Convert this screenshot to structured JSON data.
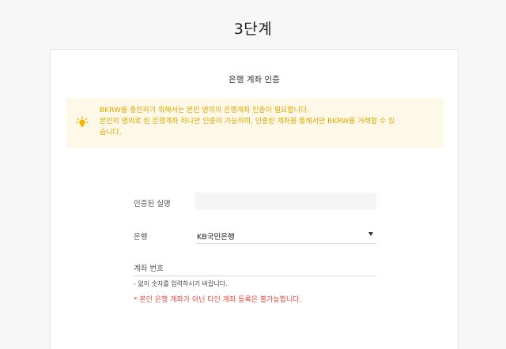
{
  "step_title": "3단계",
  "card": {
    "title": "은행 계좌 인증",
    "notice": {
      "icon": "lightbulb-icon",
      "color": "#e0a800",
      "line1": "BKRW를 충전하기 위해서는 본인 명의의 은행계좌 인증이 필요합니다.",
      "line2": "본인의 명의로 된 은행계좌 하나만 인증이 가능하며, 인증된 계좌를 통해서만 BKRW를 거래할 수 있",
      "line3": "습니다."
    },
    "form": {
      "name_label": "인증된 실명",
      "name_value": "",
      "bank_label": "은행",
      "bank_selected": "KB국민은행",
      "account_placeholder": "계좌 번호",
      "hint": "- 없이 숫자를 입력하시기 바랍니다.",
      "warning": "* 본인 은행 계좌가 아닌 타인 계좌 등록은 불가능합니다.",
      "warning_color": "#e8483f"
    }
  }
}
